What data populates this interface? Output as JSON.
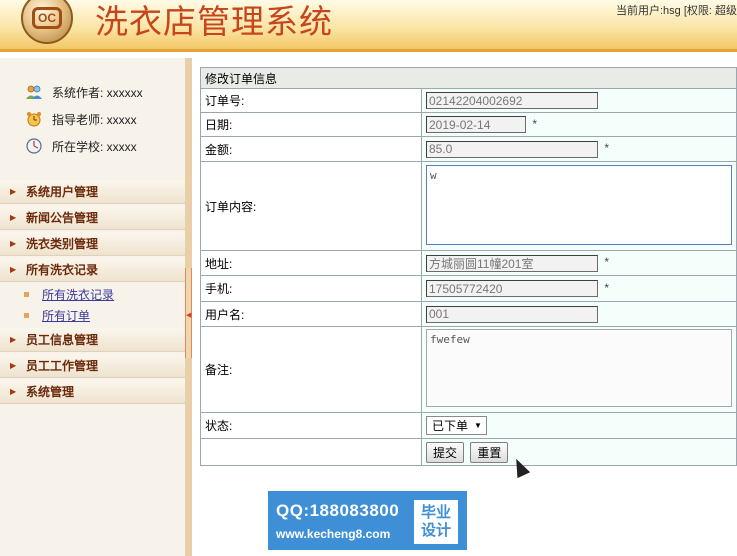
{
  "header": {
    "logo_text": "OC",
    "title": "洗衣店管理系统",
    "user_info": "当前用户:hsg [权限: 超级"
  },
  "sidebar": {
    "info": [
      {
        "label": "系统作者: xxxxxx",
        "icon": "user-group-icon"
      },
      {
        "label": "指导老师: xxxxx",
        "icon": "alarm-clock-icon"
      },
      {
        "label": "所在学校: xxxxx",
        "icon": "clock-icon"
      }
    ],
    "menu": [
      {
        "label": "系统用户管理"
      },
      {
        "label": "新闻公告管理"
      },
      {
        "label": "洗衣类别管理"
      },
      {
        "label": "所有洗衣记录"
      },
      {
        "label": "员工信息管理"
      },
      {
        "label": "员工工作管理"
      },
      {
        "label": "系统管理"
      }
    ],
    "submenu": [
      {
        "label": "所有洗衣记录"
      },
      {
        "label": "所有订单"
      }
    ]
  },
  "form": {
    "caption": "修改订单信息",
    "order_no": {
      "label": "订单号:",
      "value": "02142204002692"
    },
    "date": {
      "label": "日期:",
      "value": "2019-02-14",
      "required": "*"
    },
    "amount": {
      "label": "金额:",
      "value": "85.0",
      "required": "*"
    },
    "content": {
      "label": "订单内容:",
      "value": "w"
    },
    "address": {
      "label": "地址:",
      "value": "方城丽圆11幢201室",
      "required": "*"
    },
    "phone": {
      "label": "手机:",
      "value": "17505772420",
      "required": "*"
    },
    "username": {
      "label": "用户名:",
      "value": "001"
    },
    "remark": {
      "label": "备注:",
      "value": "fwefew"
    },
    "status": {
      "label": "状态:",
      "selected": "已下单"
    },
    "submit_label": "提交",
    "reset_label": "重置"
  },
  "watermark": {
    "qq": "QQ:188083800",
    "url": "www.kecheng8.com",
    "badge_line1": "毕业",
    "badge_line2": "设计"
  },
  "colors": {
    "title": "#c7451a",
    "menu_text": "#6b2a0c",
    "link": "#3a3a9a",
    "watermark_bg": "#3f8fd6"
  }
}
